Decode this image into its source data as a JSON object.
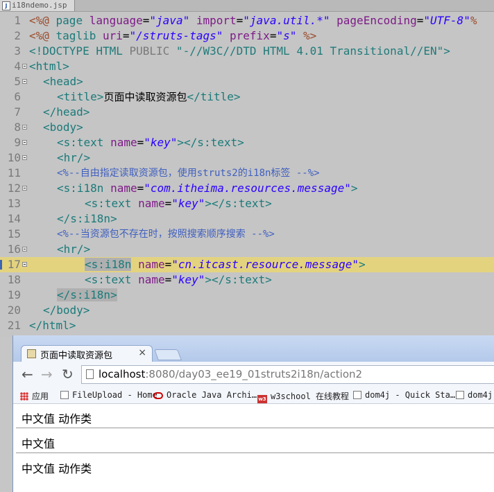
{
  "editor": {
    "tab_label": "i18ndemo.jsp",
    "tab_icon": "jsp-file-icon",
    "lines": [
      {
        "n": "1",
        "fold": false
      },
      {
        "n": "2",
        "fold": false
      },
      {
        "n": "3",
        "fold": false
      },
      {
        "n": "4",
        "fold": true
      },
      {
        "n": "5",
        "fold": true
      },
      {
        "n": "6",
        "fold": false
      },
      {
        "n": "7",
        "fold": false
      },
      {
        "n": "8",
        "fold": true
      },
      {
        "n": "9",
        "fold": true
      },
      {
        "n": "10",
        "fold": true
      },
      {
        "n": "11",
        "fold": false
      },
      {
        "n": "12",
        "fold": true
      },
      {
        "n": "13",
        "fold": false
      },
      {
        "n": "14",
        "fold": false
      },
      {
        "n": "15",
        "fold": false
      },
      {
        "n": "16",
        "fold": true
      },
      {
        "n": "17",
        "fold": true
      },
      {
        "n": "18",
        "fold": false
      },
      {
        "n": "19",
        "fold": false
      },
      {
        "n": "20",
        "fold": false
      },
      {
        "n": "21",
        "fold": false
      }
    ],
    "code": {
      "l1": {
        "p1": "<%@",
        "p2": " page ",
        "p3": "language",
        "p4": "=",
        "p5": "\"java\"",
        "p6": " ",
        "p7": "import",
        "p8": "=",
        "p9": "\"java.util.*\"",
        "p10": " ",
        "p11": "pageEncoding",
        "p12": "=",
        "p13": "\"UTF-8\"",
        "p14": "%"
      },
      "l2": {
        "p1": "<%@",
        "p2": " taglib ",
        "p3": "uri",
        "p4": "=",
        "p5": "\"/struts-tags\"",
        "p6": " ",
        "p7": "prefix",
        "p8": "=",
        "p9": "\"s\"",
        "p10": " %>"
      },
      "l3": {
        "p1": "<!DOCTYPE HTML ",
        "p2": "PUBLIC",
        "p3": " \"-//W3C//DTD HTML 4.01 Transitional//EN\">"
      },
      "l4": "<html>",
      "l5": "<head>",
      "l6": {
        "p1": "<title>",
        "p2": "页面中读取资源包",
        "p3": "</title>"
      },
      "l7": "</head>",
      "l8": "<body>",
      "l9": {
        "p1": "<s:text ",
        "p2": "name",
        "p3": "=",
        "p4": "\"key\"",
        "p5": "></s:text>"
      },
      "l10": "<hr/>",
      "l11": "<%--自由指定读取资源包，使用struts2的i18n标签 --%>",
      "l12": {
        "p1": "<s:i18n ",
        "p2": "name",
        "p3": "=",
        "p4": "\"com.itheima.resources.message\"",
        "p5": ">"
      },
      "l13": {
        "p1": "<s:text ",
        "p2": "name",
        "p3": "=",
        "p4": "\"key\"",
        "p5": "></s:text>"
      },
      "l14": "</s:i18n>",
      "l15": "<%--当资源包不存在时，按照搜索顺序搜索 --%>",
      "l16": "<hr/>",
      "l17": {
        "p1": "<s:i18n",
        "p2": " name",
        "p3": "=",
        "p4": "\"cn.itcast.resource.message\"",
        "p5": ">"
      },
      "l18": {
        "p1": "<s:text ",
        "p2": "name",
        "p3": "=",
        "p4": "\"key\"",
        "p5": "></s:text>"
      },
      "l19": "</s:i18n>",
      "l20": "</body>",
      "l21": "</html>"
    }
  },
  "browser": {
    "tab_title": "页面中读取资源包",
    "tab_close": "×",
    "back": "←",
    "forward": "→",
    "reload": "↻",
    "url_host": "localhost",
    "url_rest": ":8080/day03_ee19_01struts2i18n/action2",
    "bookmarks": [
      {
        "label": "应用",
        "icon": "apps-icon"
      },
      {
        "label": "FileUpload - Home",
        "icon": "page-icon"
      },
      {
        "label": "Oracle Java Archi…",
        "icon": "oracle-icon"
      },
      {
        "label": "w3school 在线教程",
        "icon": "w3school-icon"
      },
      {
        "label": "dom4j - Quick Sta…",
        "icon": "page-icon"
      },
      {
        "label": "dom4j",
        "icon": "page-icon"
      }
    ],
    "content_lines": [
      "中文值 动作类",
      "中文值",
      "中文值 动作类"
    ]
  }
}
